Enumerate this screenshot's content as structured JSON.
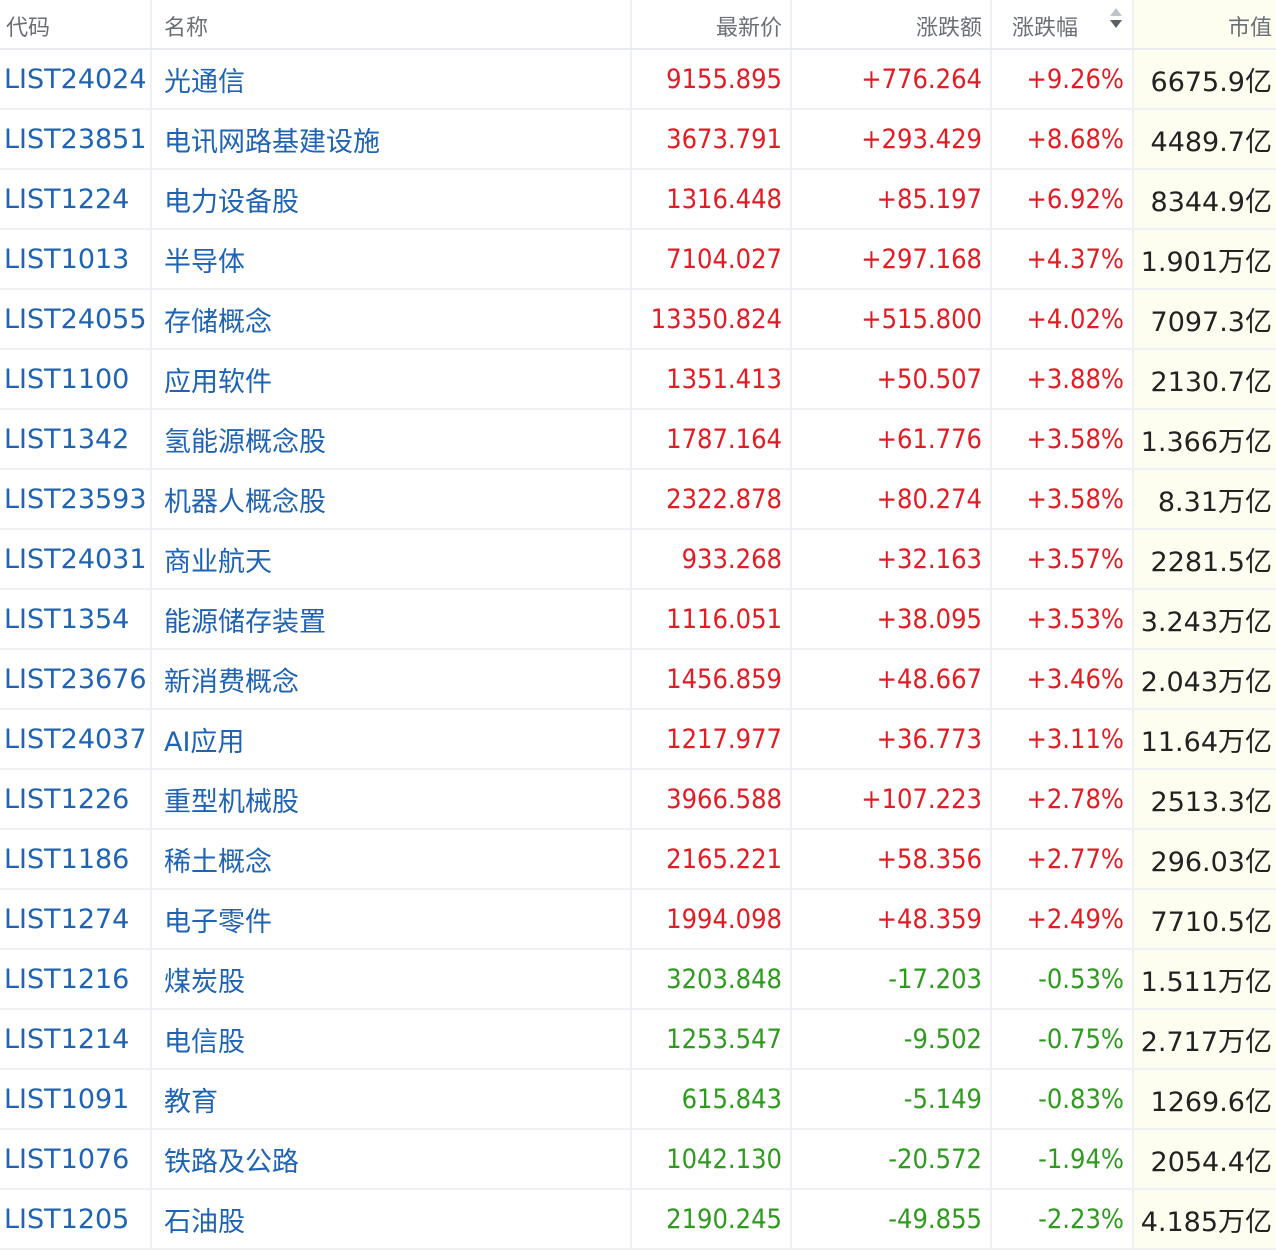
{
  "headers": {
    "code": "代码",
    "name": "名称",
    "price": "最新价",
    "change": "涨跌额",
    "pct": "涨跌幅",
    "cap": "市值"
  },
  "colors": {
    "up": "#e31b23",
    "down": "#2e9a1e",
    "link": "#1e63b4"
  },
  "rows": [
    {
      "code": "LIST24024",
      "name": "光通信",
      "price": "9155.895",
      "change": "+776.264",
      "pct": "+9.26%",
      "cap": "6675.9亿",
      "dir": "up"
    },
    {
      "code": "LIST23851",
      "name": "电讯网路基建设施",
      "price": "3673.791",
      "change": "+293.429",
      "pct": "+8.68%",
      "cap": "4489.7亿",
      "dir": "up"
    },
    {
      "code": "LIST1224",
      "name": "电力设备股",
      "price": "1316.448",
      "change": "+85.197",
      "pct": "+6.92%",
      "cap": "8344.9亿",
      "dir": "up"
    },
    {
      "code": "LIST1013",
      "name": "半导体",
      "price": "7104.027",
      "change": "+297.168",
      "pct": "+4.37%",
      "cap": "1.901万亿",
      "dir": "up"
    },
    {
      "code": "LIST24055",
      "name": "存储概念",
      "price": "13350.824",
      "change": "+515.800",
      "pct": "+4.02%",
      "cap": "7097.3亿",
      "dir": "up"
    },
    {
      "code": "LIST1100",
      "name": "应用软件",
      "price": "1351.413",
      "change": "+50.507",
      "pct": "+3.88%",
      "cap": "2130.7亿",
      "dir": "up"
    },
    {
      "code": "LIST1342",
      "name": "氢能源概念股",
      "price": "1787.164",
      "change": "+61.776",
      "pct": "+3.58%",
      "cap": "1.366万亿",
      "dir": "up"
    },
    {
      "code": "LIST23593",
      "name": "机器人概念股",
      "price": "2322.878",
      "change": "+80.274",
      "pct": "+3.58%",
      "cap": "8.31万亿",
      "dir": "up"
    },
    {
      "code": "LIST24031",
      "name": "商业航天",
      "price": "933.268",
      "change": "+32.163",
      "pct": "+3.57%",
      "cap": "2281.5亿",
      "dir": "up"
    },
    {
      "code": "LIST1354",
      "name": "能源储存装置",
      "price": "1116.051",
      "change": "+38.095",
      "pct": "+3.53%",
      "cap": "3.243万亿",
      "dir": "up"
    },
    {
      "code": "LIST23676",
      "name": "新消费概念",
      "price": "1456.859",
      "change": "+48.667",
      "pct": "+3.46%",
      "cap": "2.043万亿",
      "dir": "up"
    },
    {
      "code": "LIST24037",
      "name": "AI应用",
      "price": "1217.977",
      "change": "+36.773",
      "pct": "+3.11%",
      "cap": "11.64万亿",
      "dir": "up"
    },
    {
      "code": "LIST1226",
      "name": "重型机械股",
      "price": "3966.588",
      "change": "+107.223",
      "pct": "+2.78%",
      "cap": "2513.3亿",
      "dir": "up"
    },
    {
      "code": "LIST1186",
      "name": "稀土概念",
      "price": "2165.221",
      "change": "+58.356",
      "pct": "+2.77%",
      "cap": "296.03亿",
      "dir": "up"
    },
    {
      "code": "LIST1274",
      "name": "电子零件",
      "price": "1994.098",
      "change": "+48.359",
      "pct": "+2.49%",
      "cap": "7710.5亿",
      "dir": "up"
    },
    {
      "code": "LIST1216",
      "name": "煤炭股",
      "price": "3203.848",
      "change": "-17.203",
      "pct": "-0.53%",
      "cap": "1.511万亿",
      "dir": "down"
    },
    {
      "code": "LIST1214",
      "name": "电信股",
      "price": "1253.547",
      "change": "-9.502",
      "pct": "-0.75%",
      "cap": "2.717万亿",
      "dir": "down"
    },
    {
      "code": "LIST1091",
      "name": "教育",
      "price": "615.843",
      "change": "-5.149",
      "pct": "-0.83%",
      "cap": "1269.6亿",
      "dir": "down"
    },
    {
      "code": "LIST1076",
      "name": "铁路及公路",
      "price": "1042.130",
      "change": "-20.572",
      "pct": "-1.94%",
      "cap": "2054.4亿",
      "dir": "down"
    },
    {
      "code": "LIST1205",
      "name": "石油股",
      "price": "2190.245",
      "change": "-49.855",
      "pct": "-2.23%",
      "cap": "4.185万亿",
      "dir": "down"
    }
  ]
}
